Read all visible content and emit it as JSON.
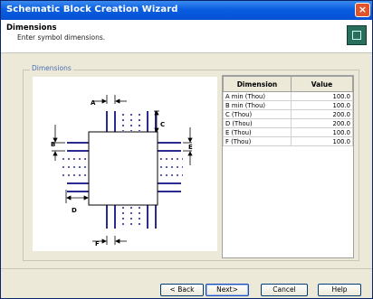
{
  "window": {
    "title": "Schematic Block Creation Wizard",
    "close_label": "×"
  },
  "header": {
    "title": "Dimensions",
    "subtitle": "Enter symbol dimensions."
  },
  "group": {
    "label": "Dimensions"
  },
  "diagram": {
    "labels": {
      "A": "A",
      "B": "B",
      "C": "C",
      "D": "D",
      "E": "E",
      "F": "F"
    }
  },
  "table": {
    "headers": {
      "dimension": "Dimension",
      "value": "Value"
    },
    "rows": [
      {
        "name": "A min (Thou)",
        "value": "100.0"
      },
      {
        "name": "B min (Thou)",
        "value": "100.0"
      },
      {
        "name": "C (Thou)",
        "value": "200.0"
      },
      {
        "name": "D (Thou)",
        "value": "200.0"
      },
      {
        "name": "E (Thou)",
        "value": "100.0"
      },
      {
        "name": "F (Thou)",
        "value": "100.0"
      }
    ]
  },
  "buttons": {
    "back": "< Back",
    "next": "Next>",
    "cancel": "Cancel",
    "help": "Help"
  },
  "colors": {
    "titlebar": "#0550d4",
    "pins": "#2b2a8f",
    "group_label": "#4a6fb3"
  }
}
